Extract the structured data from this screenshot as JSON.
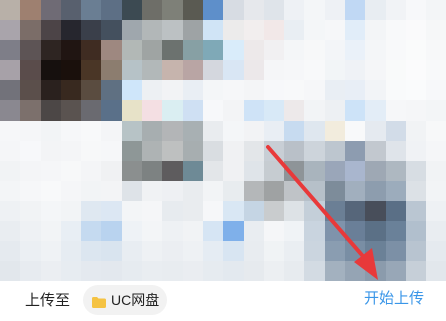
{
  "bottom_bar": {
    "upload_to_label": "上传至",
    "destination_label": "UC网盘",
    "start_upload_label": "开始上传"
  },
  "colors": {
    "accent": "#3a96e8",
    "folder": "#f5c343",
    "annotation_arrow": "#e8393a",
    "chip_background": "#f2f2f2"
  },
  "icons": {
    "destination": "folder-icon",
    "annotation": "red-arrow-icon"
  }
}
